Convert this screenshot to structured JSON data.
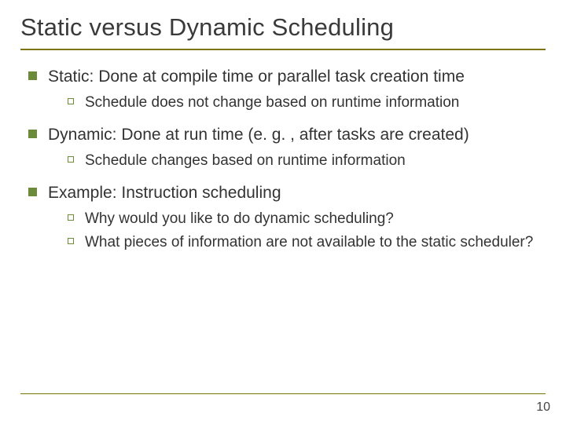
{
  "title": "Static versus Dynamic Scheduling",
  "bullets": [
    {
      "text": "Static: Done at compile time or parallel task creation time",
      "sub": [
        "Schedule does not change based on runtime information"
      ]
    },
    {
      "text": "Dynamic: Done at run time (e. g. , after tasks are created)",
      "sub": [
        "Schedule changes based on runtime information"
      ]
    },
    {
      "text": "Example: Instruction scheduling",
      "sub": [
        "Why would you like to do dynamic scheduling?",
        "What pieces of information are not available to the static scheduler?"
      ]
    }
  ],
  "page_number": "10"
}
